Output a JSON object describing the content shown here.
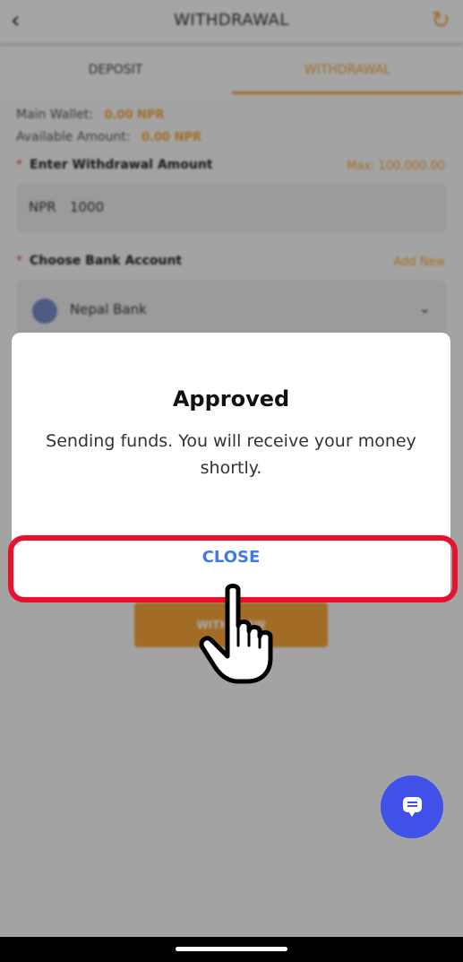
{
  "header": {
    "title": "WITHDRAWAL",
    "back_icon": "chevron-left-icon",
    "refresh_icon": "refresh-icon"
  },
  "tabs": [
    {
      "label": "DEPOSIT"
    },
    {
      "label": "WITHDRAWAL"
    }
  ],
  "wallet": {
    "main_label": "Main Wallet:",
    "main_value": "0.00 NPR",
    "available_label": "Available Amount:",
    "available_value": "0.00 NPR"
  },
  "amount": {
    "label": "Enter Withdrawal Amount",
    "max": "Max: 100,000.00",
    "currency": "NPR",
    "value": "1000"
  },
  "bank": {
    "label": "Choose Bank Account",
    "add_new": "Add New",
    "selected": "Nepal Bank"
  },
  "withdraw_button": {
    "label": "WITHDRAW"
  },
  "dialog": {
    "title": "Approved",
    "message": "Sending funds. You will receive your money shortly.",
    "close_label": "CLOSE"
  },
  "colors": {
    "accent": "#f2a23a",
    "highlight": "#e8122e",
    "link": "#3f7ae8",
    "chat": "#3f51e8"
  }
}
